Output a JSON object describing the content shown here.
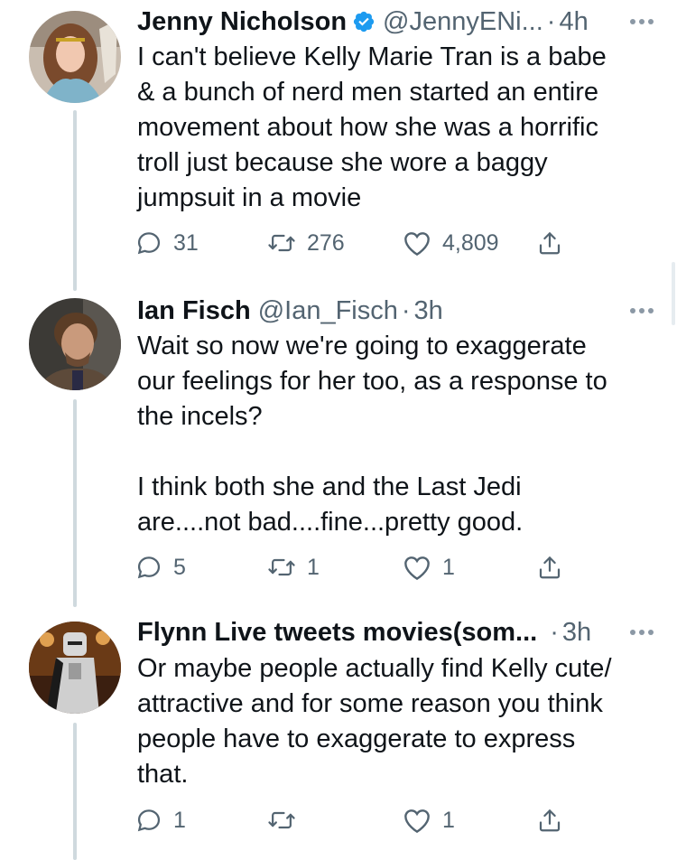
{
  "tweets": [
    {
      "name": "Jenny Nicholson",
      "verified": true,
      "handle": "@JennyENi...",
      "separator": "·",
      "time": "4h",
      "text": "I can't believe Kelly Marie Tran is a babe\n& a bunch of nerd men started an entire\nmovement about how she was a horrific\ntroll just because she wore a baggy\njumpsuit in a movie",
      "replies": "31",
      "retweets": "276",
      "likes": "4,809"
    },
    {
      "name": "Ian Fisch",
      "verified": false,
      "handle": "@Ian_Fisch",
      "separator": "·",
      "time": "3h",
      "text": "Wait so now we're going to exaggerate\nour feelings for her too, as a response to\nthe incels?\n\nI think both she and the Last Jedi\nare....not bad....fine...pretty good.",
      "replies": "5",
      "retweets": "1",
      "likes": "1"
    },
    {
      "name": "Flynn Live tweets movies(som...",
      "verified": false,
      "handle": "",
      "separator": "·",
      "time": "3h",
      "text": "Or maybe people actually find Kelly cute/\nattractive and for some reason you think\npeople have to exaggerate to express\nthat.",
      "replies": "1",
      "retweets": "",
      "likes": "1"
    }
  ],
  "icons": {
    "verified": "verified-badge-icon",
    "more": "more-horizontal-icon",
    "reply": "reply-icon",
    "retweet": "retweet-icon",
    "like": "heart-icon",
    "share": "share-icon"
  },
  "colors": {
    "accent": "#1d9bf0",
    "text": "#0f1419",
    "secondary": "#536471",
    "thread_line": "#cfd9de"
  }
}
